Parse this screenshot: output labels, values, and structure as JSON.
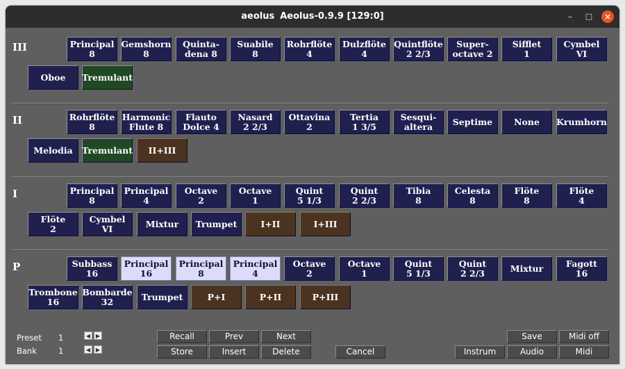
{
  "window": {
    "title_app": "aeolus",
    "title_version": "Aeolus-0.9.9",
    "title_port": "[129:0]",
    "min_icon": "minimize-icon",
    "max_icon": "maximize-icon",
    "close_icon": "close-icon"
  },
  "colors": {
    "stop_off": "#20204f",
    "stop_on": "#dcdcfa",
    "tremulant": "#204824",
    "coupler": "#4a3320",
    "background": "#5f5f5f"
  },
  "divisions": [
    {
      "label": "III",
      "stops": [
        {
          "l1": "Principal",
          "l2": "8",
          "state": "off"
        },
        {
          "l1": "Gemshorn",
          "l2": "8",
          "state": "off"
        },
        {
          "l1": "Quinta-",
          "l2": "dena 8",
          "state": "off"
        },
        {
          "l1": "Suabile",
          "l2": "8",
          "state": "off"
        },
        {
          "l1": "Rohrflöte",
          "l2": "4",
          "state": "off"
        },
        {
          "l1": "Dulzflöte",
          "l2": "4",
          "state": "off"
        },
        {
          "l1": "Quintflöte",
          "l2": "2 2/3",
          "state": "off"
        },
        {
          "l1": "Super-",
          "l2": "octave 2",
          "state": "off"
        },
        {
          "l1": "Sifflet",
          "l2": "1",
          "state": "off"
        },
        {
          "l1": "Cymbel",
          "l2": "VI",
          "state": "off"
        },
        {
          "l1": "Oboe",
          "l2": "",
          "state": "off"
        },
        {
          "l1": "Tremulant",
          "l2": "",
          "state": "tremulant"
        }
      ]
    },
    {
      "label": "II",
      "stops": [
        {
          "l1": "Rohrflöte",
          "l2": "8",
          "state": "off"
        },
        {
          "l1": "Harmonic",
          "l2": "Flute 8",
          "state": "off"
        },
        {
          "l1": "Flauto",
          "l2": "Dolce 4",
          "state": "off"
        },
        {
          "l1": "Nasard",
          "l2": "2 2/3",
          "state": "off"
        },
        {
          "l1": "Ottavina",
          "l2": "2",
          "state": "off"
        },
        {
          "l1": "Tertia",
          "l2": "1 3/5",
          "state": "off"
        },
        {
          "l1": "Sesqui-",
          "l2": "altera",
          "state": "off"
        },
        {
          "l1": "Septime",
          "l2": "",
          "state": "off"
        },
        {
          "l1": "None",
          "l2": "",
          "state": "off"
        },
        {
          "l1": "Krumhorn",
          "l2": "",
          "state": "off"
        },
        {
          "l1": "Melodia",
          "l2": "",
          "state": "off"
        },
        {
          "l1": "Tremulant",
          "l2": "",
          "state": "tremulant"
        },
        {
          "l1": "II+III",
          "l2": "",
          "state": "coupler"
        }
      ]
    },
    {
      "label": "I",
      "stops": [
        {
          "l1": "Principal",
          "l2": "8",
          "state": "off"
        },
        {
          "l1": "Principal",
          "l2": "4",
          "state": "off"
        },
        {
          "l1": "Octave",
          "l2": "2",
          "state": "off"
        },
        {
          "l1": "Octave",
          "l2": "1",
          "state": "off"
        },
        {
          "l1": "Quint",
          "l2": "5 1/3",
          "state": "off"
        },
        {
          "l1": "Quint",
          "l2": "2 2/3",
          "state": "off"
        },
        {
          "l1": "Tibia",
          "l2": "8",
          "state": "off"
        },
        {
          "l1": "Celesta",
          "l2": "8",
          "state": "off"
        },
        {
          "l1": "Flöte",
          "l2": "8",
          "state": "off"
        },
        {
          "l1": "Flöte",
          "l2": "4",
          "state": "off"
        },
        {
          "l1": "Flöte",
          "l2": "2",
          "state": "off"
        },
        {
          "l1": "Cymbel",
          "l2": "VI",
          "state": "off"
        },
        {
          "l1": "Mixtur",
          "l2": "",
          "state": "off"
        },
        {
          "l1": "Trumpet",
          "l2": "",
          "state": "off"
        },
        {
          "l1": "I+II",
          "l2": "",
          "state": "coupler"
        },
        {
          "l1": "I+III",
          "l2": "",
          "state": "coupler"
        }
      ]
    },
    {
      "label": "P",
      "stops": [
        {
          "l1": "Subbass",
          "l2": "16",
          "state": "off"
        },
        {
          "l1": "Principal",
          "l2": "16",
          "state": "on"
        },
        {
          "l1": "Principal",
          "l2": "8",
          "state": "on"
        },
        {
          "l1": "Principal",
          "l2": "4",
          "state": "on"
        },
        {
          "l1": "Octave",
          "l2": "2",
          "state": "off"
        },
        {
          "l1": "Octave",
          "l2": "1",
          "state": "off"
        },
        {
          "l1": "Quint",
          "l2": "5 1/3",
          "state": "off"
        },
        {
          "l1": "Quint",
          "l2": "2 2/3",
          "state": "off"
        },
        {
          "l1": "Mixtur",
          "l2": "",
          "state": "off"
        },
        {
          "l1": "Fagott",
          "l2": "16",
          "state": "off"
        },
        {
          "l1": "Trombone",
          "l2": "16",
          "state": "off"
        },
        {
          "l1": "Bombarde",
          "l2": "32",
          "state": "off"
        },
        {
          "l1": "Trumpet",
          "l2": "",
          "state": "off"
        },
        {
          "l1": "P+I",
          "l2": "",
          "state": "coupler"
        },
        {
          "l1": "P+II",
          "l2": "",
          "state": "coupler"
        },
        {
          "l1": "P+III",
          "l2": "",
          "state": "coupler"
        }
      ]
    }
  ],
  "controls": {
    "preset_label": "Preset",
    "preset_value": "1",
    "bank_label": "Bank",
    "bank_value": "1",
    "arrow_left": "◀",
    "arrow_right": "▶",
    "buttons": {
      "recall": "Recall",
      "prev": "Prev",
      "next": "Next",
      "store": "Store",
      "insert": "Insert",
      "delete": "Delete",
      "cancel": "Cancel",
      "save": "Save",
      "midi_off": "Midi off",
      "instrum": "Instrum",
      "audio": "Audio",
      "midi": "Midi"
    }
  }
}
